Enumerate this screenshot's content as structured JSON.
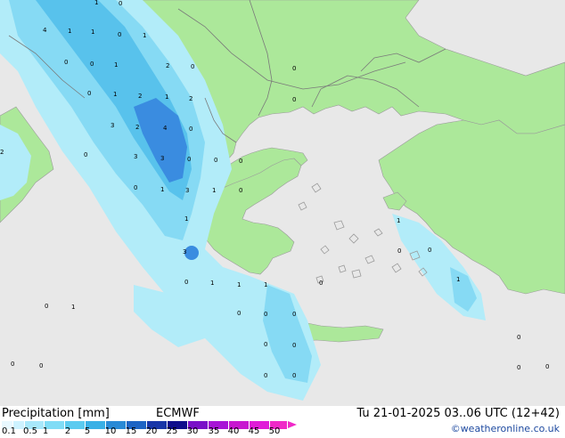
{
  "legend": {
    "title": "Precipitation [mm]",
    "model": "ECMWF",
    "ticks": [
      "0.1",
      "0.5",
      "1",
      "2",
      "5",
      "10",
      "15",
      "20",
      "25",
      "30",
      "35",
      "40",
      "45",
      "50"
    ],
    "colors": [
      "#e8f8ff",
      "#cdf2ff",
      "#a8e8fb",
      "#80dcf6",
      "#5ccbf0",
      "#3ab0e6",
      "#2a8ad6",
      "#1e64c4",
      "#1836a8",
      "#100e8c",
      "#7a10c8",
      "#a814d6",
      "#c818d0",
      "#e01cd8",
      "#f028c8"
    ]
  },
  "valid_time": "Tu 21-01-2025 03..06 UTC (12+42)",
  "copyright": "©weatheronline.co.uk",
  "map_colors": {
    "land": "#ace89a",
    "sea": "#e8e8e8",
    "coast": "#9a9a9a",
    "border": "#7a7a7a",
    "precip_light": "#b2ecf9",
    "precip_mid": "#86daf4",
    "precip_heavy": "#58c2ec",
    "precip_peak": "#3a8ce0"
  },
  "grid_values": [
    "4",
    "1",
    "1",
    "0",
    "1",
    "1",
    "0",
    "0",
    "0",
    "2",
    "1",
    "0",
    "0",
    "0",
    "1",
    "2",
    "1",
    "2",
    "0",
    "3",
    "2",
    "4",
    "0",
    "2",
    "3",
    "3",
    "0",
    "0",
    "0",
    "1",
    "3",
    "1",
    "0",
    "0",
    "1",
    "1",
    "3",
    "1",
    "1",
    "1",
    "0",
    "0",
    "1",
    "0",
    "0",
    "0",
    "0",
    "0",
    "0",
    "0",
    "0",
    "0",
    "0",
    "0",
    "0",
    "1",
    "0",
    "0",
    "0",
    "0"
  ]
}
